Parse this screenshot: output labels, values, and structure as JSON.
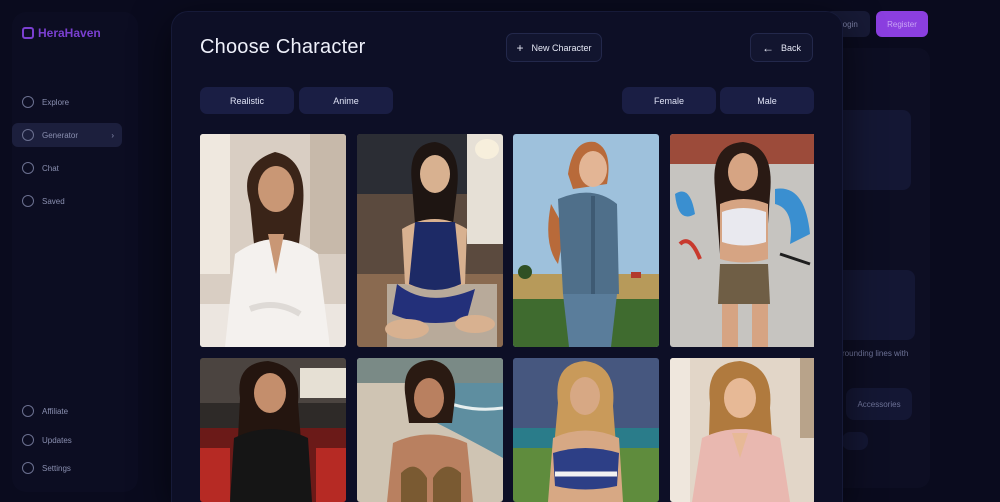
{
  "background_app": {
    "logo": "HeraHaven",
    "nav": [
      {
        "label": "Explore",
        "icon": "compass-icon"
      },
      {
        "label": "Generator",
        "icon": "image-icon"
      },
      {
        "label": "Chat",
        "icon": "chat-icon"
      },
      {
        "label": "Saved",
        "icon": "bookmark-icon"
      }
    ],
    "footer_nav": [
      {
        "label": "Affiliate",
        "icon": "trophy-icon"
      },
      {
        "label": "Updates",
        "icon": "refresh-icon"
      },
      {
        "label": "Settings",
        "icon": "gear-icon"
      }
    ],
    "login_label": "Login",
    "register_label": "Register",
    "right_panel_text": "rounding lines with",
    "accessories_label": "Accessories"
  },
  "modal": {
    "title": "Choose Character",
    "new_character_label": "New Character",
    "back_label": "Back",
    "style_filters": [
      "Realistic",
      "Anime"
    ],
    "gender_filters": [
      "Female",
      "Male"
    ]
  },
  "characters": [
    {
      "scene": "bathroom",
      "outfit": "white bathrobe",
      "accent": "#f4f1ee"
    },
    {
      "scene": "living-room",
      "outfit": "navy satin dress",
      "accent": "#1d2a66"
    },
    {
      "scene": "field",
      "outfit": "denim jumpsuit",
      "accent": "#4f6f8a"
    },
    {
      "scene": "graffiti wall",
      "outfit": "white crop top",
      "accent": "#e9e9ef"
    },
    {
      "scene": "cinema",
      "outfit": "black t-shirt",
      "accent": "#151515"
    },
    {
      "scene": "beach",
      "outfit": "leopard bikini",
      "accent": "#7a5a32"
    },
    {
      "scene": "stadium",
      "outfit": "sports top",
      "accent": "#2d3f86"
    },
    {
      "scene": "bedroom",
      "outfit": "pink blouse",
      "accent": "#e9b8b0"
    }
  ]
}
